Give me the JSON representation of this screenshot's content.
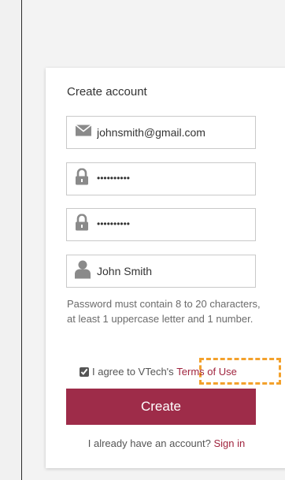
{
  "form": {
    "title": "Create account",
    "email_value": "johnsmith@gmail.com",
    "password_mask": "••••••••••",
    "confirm_mask": "••••••••••",
    "name_value": "John Smith",
    "password_hint": "Password must contain 8 to 20 characters, at least 1 uppercase letter and 1 number.",
    "agree_text": "I agree to VTech's",
    "terms_link": "Terms of Use",
    "agree_checked": true,
    "create_label": "Create",
    "have_account_text": "I already have an account?",
    "signin_link": "Sign in"
  },
  "colors": {
    "brand": "#9e2c49",
    "link": "#a0253f",
    "highlight": "#f3a12c"
  },
  "icons": [
    "email-icon",
    "lock-icon",
    "lock-icon",
    "person-icon"
  ]
}
